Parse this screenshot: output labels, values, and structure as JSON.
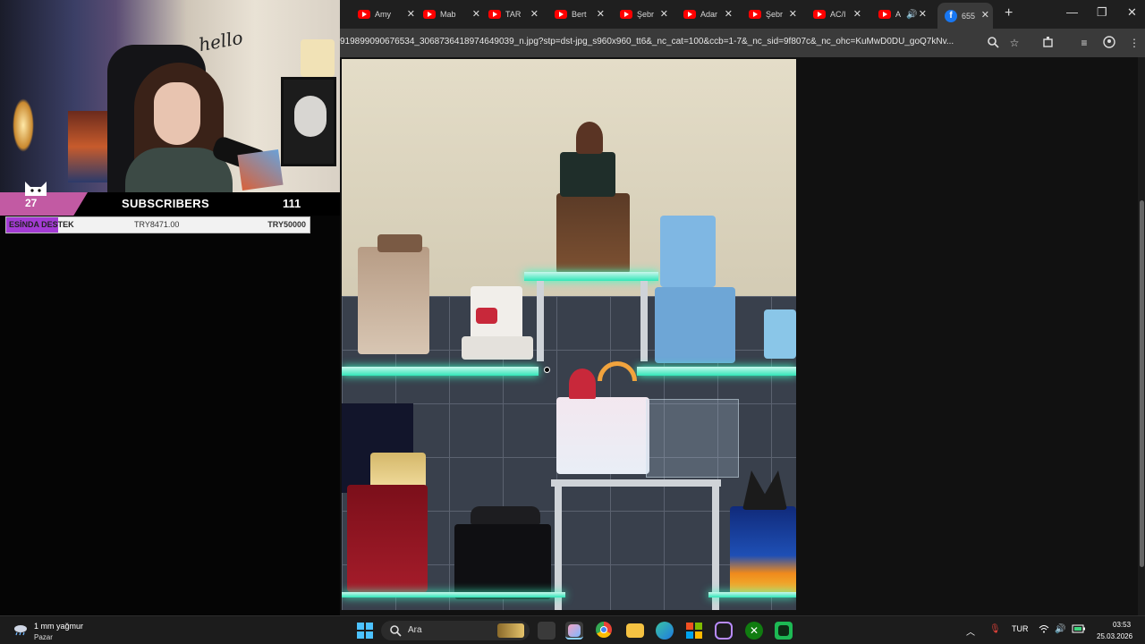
{
  "stream_overlay": {
    "webcam_hello_text": "hello",
    "subscribers": {
      "badge_count": "27",
      "label": "SUBSCRIBERS",
      "total": "111"
    },
    "donation": {
      "label": "ESİNDA DESTEK",
      "current": "TRY8471.00",
      "goal": "TRY50000",
      "fill_fraction": 0.17
    }
  },
  "browser": {
    "tabs": [
      {
        "label": "Amy",
        "icon": "youtube-icon"
      },
      {
        "label": "Mab",
        "icon": "youtube-icon"
      },
      {
        "label": "TAR",
        "icon": "youtube-icon"
      },
      {
        "label": "Bert",
        "icon": "youtube-icon"
      },
      {
        "label": "Şebr",
        "icon": "youtube-icon"
      },
      {
        "label": "Adar",
        "icon": "youtube-icon"
      },
      {
        "label": "Şebr",
        "icon": "youtube-icon"
      },
      {
        "label": "AC/I",
        "icon": "youtube-icon"
      },
      {
        "label": "A",
        "icon": "youtube-icon"
      }
    ],
    "active_tab": {
      "label": "655",
      "icon": "facebook-icon"
    },
    "url": "919899090676534_3068736418974649039_n.jpg?stp=dst-jpg_s960x960_tt6&_nc_cat=100&ccb=1-7&_nc_sid=9f807c&_nc_ohc=KuMwD0DU_goQ7kNv..."
  },
  "taskbar": {
    "weather_main": "1 mm yağmur",
    "weather_sub": "Pazar",
    "search_placeholder": "Ara",
    "language": "TUR",
    "time": "03:53",
    "date": "25.03.2026"
  },
  "colors": {
    "donation_fill": "#a43bd4",
    "subscriber_badge": "#c25aa3",
    "shelf_glow": "#31e6b8",
    "windows_accent": "#4cc2ff"
  }
}
